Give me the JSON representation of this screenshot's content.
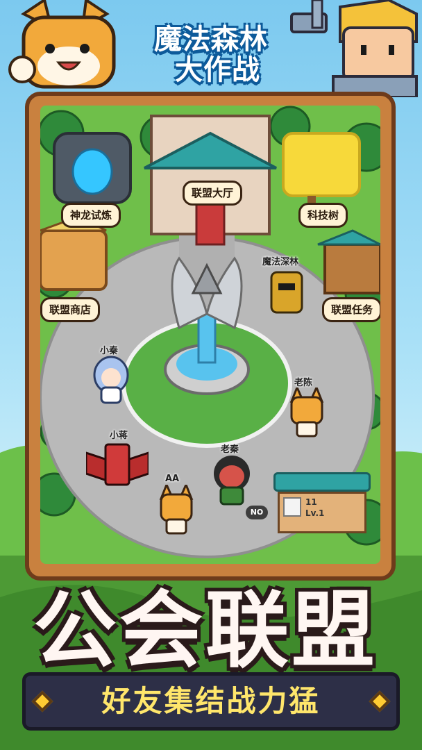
{
  "title": "魔法森林大作战",
  "title_line1": "魔法森林",
  "title_line2": "大作战",
  "locations": {
    "dragon_trial": "神龙试炼",
    "alliance_hall": "联盟大厅",
    "tech_tree": "科技树",
    "alliance_shop": "联盟商店",
    "alliance_quest": "联盟任务"
  },
  "npcs": {
    "boss": "魔法深林",
    "xiaoqin": "小秦",
    "laochen": "老陈",
    "xiaojiang": "小蒋",
    "laoqin": "老秦",
    "aa": "AA"
  },
  "no_badge": "NO",
  "rank_board": {
    "number": "11",
    "level": "Lv.1"
  },
  "banner": "公会联盟",
  "subtitle": "好友集结战力猛",
  "colors": {
    "frame": "#c9813f",
    "subtitle_text": "#ffe66b",
    "title_outline": "#0d5a9a"
  }
}
